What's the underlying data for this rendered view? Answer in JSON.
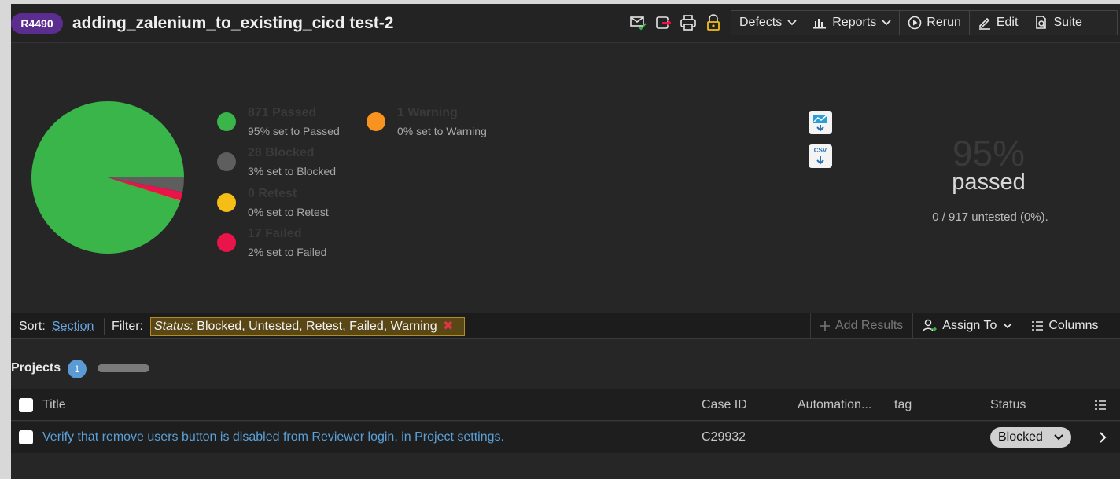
{
  "header": {
    "run_id": "R4490",
    "title": "adding_zalenium_to_existing_cicd test-2",
    "buttons": {
      "defects": "Defects",
      "reports": "Reports",
      "rerun": "Rerun",
      "edit": "Edit",
      "suite": "Suite"
    },
    "icons": [
      "email-check-icon",
      "export-icon",
      "print-icon",
      "lock-icon"
    ]
  },
  "chart_data": {
    "type": "pie",
    "categories": [
      "Passed",
      "Blocked",
      "Retest",
      "Failed",
      "Warning"
    ],
    "values": [
      871,
      28,
      0,
      17,
      1
    ],
    "colors": [
      "#3ab54a",
      "#5e5e5e",
      "#f5be16",
      "#e8144a",
      "#f7931e"
    ]
  },
  "legend": [
    {
      "count": "871 Passed",
      "pct": "95% set to Passed",
      "color": "#3ab54a"
    },
    {
      "count": "28 Blocked",
      "pct": "3% set to Blocked",
      "color": "#5e5e5e"
    },
    {
      "count": "0 Retest",
      "pct": "0% set to Retest",
      "color": "#f5be16"
    },
    {
      "count": "17 Failed",
      "pct": "2% set to Failed",
      "color": "#e8144a"
    },
    {
      "count": "1 Warning",
      "pct": "0% set to Warning",
      "color": "#f7931e"
    }
  ],
  "downloads": {
    "csv_label": "CSV"
  },
  "overview": {
    "percent": "95%",
    "label": "passed",
    "untested": "0 / 917 untested (0%)."
  },
  "toolbar": {
    "sort_label": "Sort:",
    "sort_value": "Section",
    "filter_label": "Filter:",
    "filter_key": "Status:",
    "filter_value": "Blocked, Untested, Retest, Failed, Warning",
    "filter_remove": "✖",
    "add_results": "Add Results",
    "assign_to": "Assign To",
    "columns": "Columns"
  },
  "section": {
    "title": "Projects",
    "count": "1"
  },
  "table": {
    "headers": {
      "title": "Title",
      "case_id": "Case ID",
      "automation": "Automation...",
      "tag": "tag",
      "status": "Status"
    },
    "rows": [
      {
        "title": "Verify that remove users button is disabled from Reviewer login, in Project settings.",
        "case_id": "C29932",
        "status": "Blocked"
      }
    ]
  }
}
